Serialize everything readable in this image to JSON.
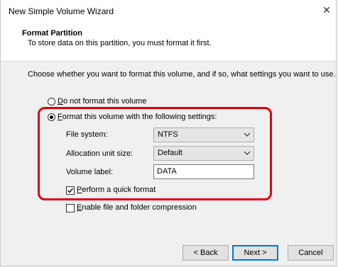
{
  "window": {
    "title": "New Simple Volume Wizard",
    "close_glyph": "✕"
  },
  "header": {
    "title": "Format Partition",
    "subtitle": "To store data on this partition, you must format it first."
  },
  "body": {
    "intro": "Choose whether you want to format this volume, and if so, what settings you want to use.",
    "option_no_format": {
      "label_mnemonic": "D",
      "label_rest": "o not format this volume",
      "selected": false
    },
    "option_format": {
      "label_mnemonic": "F",
      "label_rest": "ormat this volume with the following settings:",
      "selected": true
    },
    "file_system": {
      "label": "File system:",
      "value": "NTFS"
    },
    "allocation_unit": {
      "label": "Allocation unit size:",
      "value": "Default"
    },
    "volume_label": {
      "label": "Volume label:",
      "value": "DATA"
    },
    "quick_format": {
      "label_mnemonic": "P",
      "label_rest": "erform a quick format",
      "checked": true
    },
    "compression": {
      "label_mnemonic": "E",
      "label_rest": "nable file and folder compression",
      "checked": false
    },
    "highlight_color": "#e00000"
  },
  "footer": {
    "back": "< Back",
    "next": "Next >",
    "cancel": "Cancel"
  }
}
